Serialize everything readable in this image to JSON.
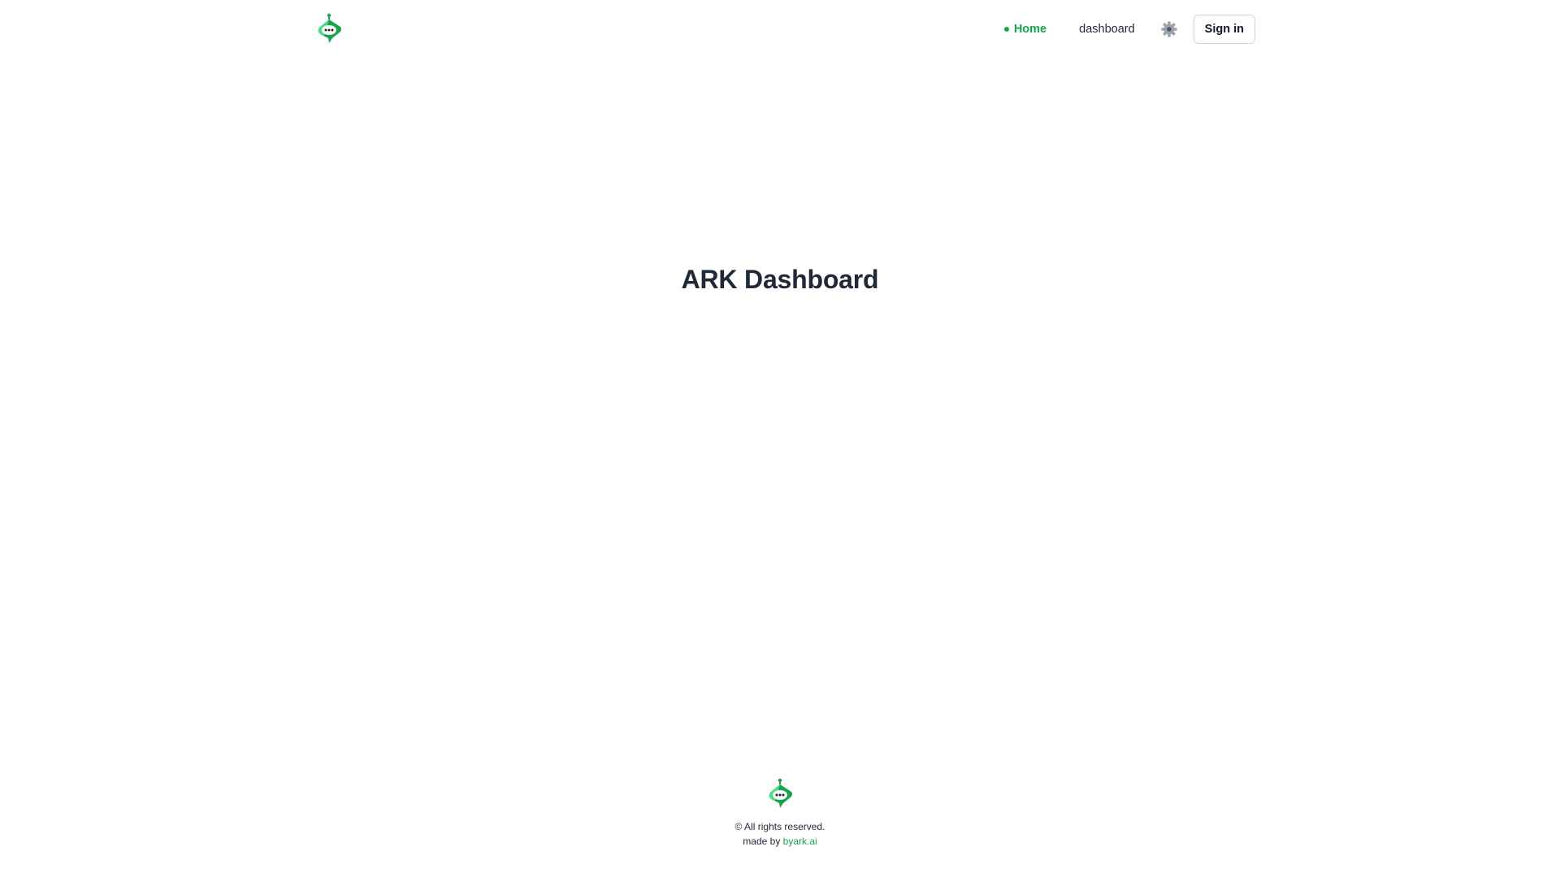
{
  "header": {
    "logo_icon": "robot-chat-logo-icon",
    "nav": {
      "home_label": "Home",
      "dashboard_label": "dashboard"
    },
    "settings_icon": "gear-icon",
    "signin_label": "Sign in"
  },
  "main": {
    "title": "ARK Dashboard"
  },
  "footer": {
    "logo_icon": "robot-chat-logo-icon",
    "copyright": "© All rights reserved.",
    "made_by_prefix": "made by",
    "made_by_link": "byark.ai"
  },
  "colors": {
    "brand_green": "#16a34a",
    "text_dark": "#1f2937",
    "gear_gray": "#9ca3af",
    "border_gray": "#d1d5db"
  }
}
